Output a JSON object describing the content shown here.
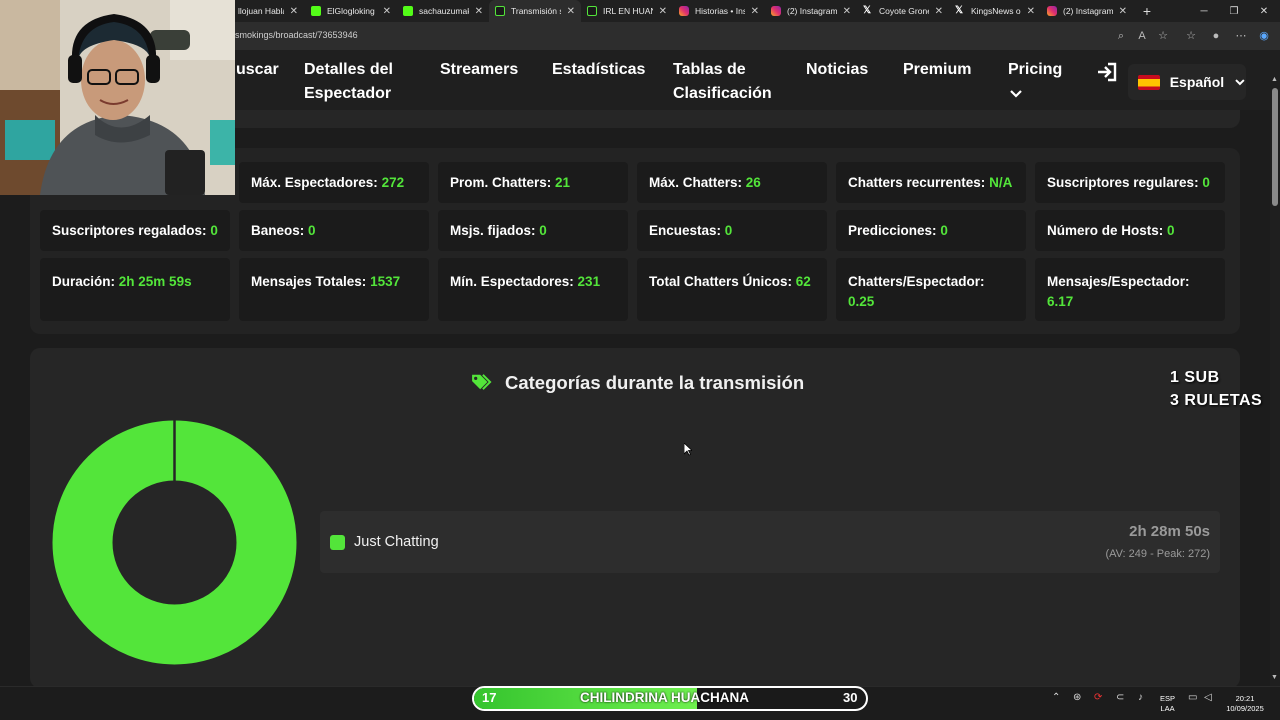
{
  "browser": {
    "tabs": [
      {
        "title": "llojuan Habla",
        "icon": "twitch-icon",
        "active": false
      },
      {
        "title": "ElGlogloking S",
        "icon": "kick-icon",
        "active": false
      },
      {
        "title": "sachauzumaki",
        "icon": "kick-icon",
        "active": false
      },
      {
        "title": "Transmisión s",
        "icon": "streamscharts-icon",
        "active": true
      },
      {
        "title": "IRL EN HUANC",
        "icon": "streamscharts-icon",
        "active": false
      },
      {
        "title": "Historias • Inst",
        "icon": "instagram-icon",
        "active": false
      },
      {
        "title": "(2) Instagram",
        "icon": "instagram-icon",
        "active": false
      },
      {
        "title": "Coyote Grone",
        "icon": "x-icon",
        "active": false
      },
      {
        "title": "KingsNews on",
        "icon": "x-icon",
        "active": false
      },
      {
        "title": "(2) Instagram",
        "icon": "instagram-icon",
        "active": false
      }
    ],
    "url": "smokings/broadcast/73653946"
  },
  "nav": {
    "items": [
      {
        "label": "uscar"
      },
      {
        "label": "Detalles del\nEspectador"
      },
      {
        "label": "Streamers"
      },
      {
        "label": "Estadísticas"
      },
      {
        "label": "Tablas de\nClasificación"
      },
      {
        "label": "Noticias"
      },
      {
        "label": "Premium"
      },
      {
        "label": "Pricing"
      }
    ],
    "language": "Español"
  },
  "stats": [
    {
      "label": "Máx. Espectadores:",
      "value": "272"
    },
    {
      "label": "Prom. Chatters:",
      "value": "21"
    },
    {
      "label": "Máx. Chatters:",
      "value": "26"
    },
    {
      "label": "Chatters recurrentes:",
      "value": "N/A"
    },
    {
      "label": "Suscriptores regulares:",
      "value": "0"
    },
    {
      "label": "Suscriptores regalados:",
      "value": "0"
    },
    {
      "label": "Baneos:",
      "value": "0"
    },
    {
      "label": "Msjs. fijados:",
      "value": "0"
    },
    {
      "label": "Encuestas:",
      "value": "0"
    },
    {
      "label": "Predicciones:",
      "value": "0"
    },
    {
      "label": "Número de Hosts:",
      "value": "0"
    },
    {
      "label": "Duración:",
      "value": "2h 25m 59s"
    },
    {
      "label": "Mensajes Totales:",
      "value": "1537"
    },
    {
      "label": "Mín. Espectadores:",
      "value": "231"
    },
    {
      "label": "Total Chatters Únicos:",
      "value": "62"
    },
    {
      "label": "Chatters/Espectador:",
      "value": "0.25"
    },
    {
      "label": "Mensajes/Espectador:",
      "value": "6.17"
    }
  ],
  "categories": {
    "title": "Categorías durante la transmisión",
    "items": [
      {
        "name": "Just Chatting",
        "duration": "2h 28m 50s",
        "meta": "(AV: 249 - Peak: 272)",
        "share": 1.0,
        "color": "#53e53a"
      }
    ]
  },
  "overlay": {
    "line1": "1 SUB",
    "line2": "3 RULETAS",
    "gauge_left": "17",
    "gauge_center": "CHILINDRINA HUACHANA",
    "gauge_right": "30",
    "gauge_fill": 0.57
  },
  "taskbar": {
    "lang_line1": "ESP",
    "lang_line2": "LAA",
    "time": "20:21",
    "date": "10/09/2025"
  },
  "colors": {
    "accent": "#53e53a",
    "background": "#1c1c1c",
    "panel": "#232323"
  }
}
